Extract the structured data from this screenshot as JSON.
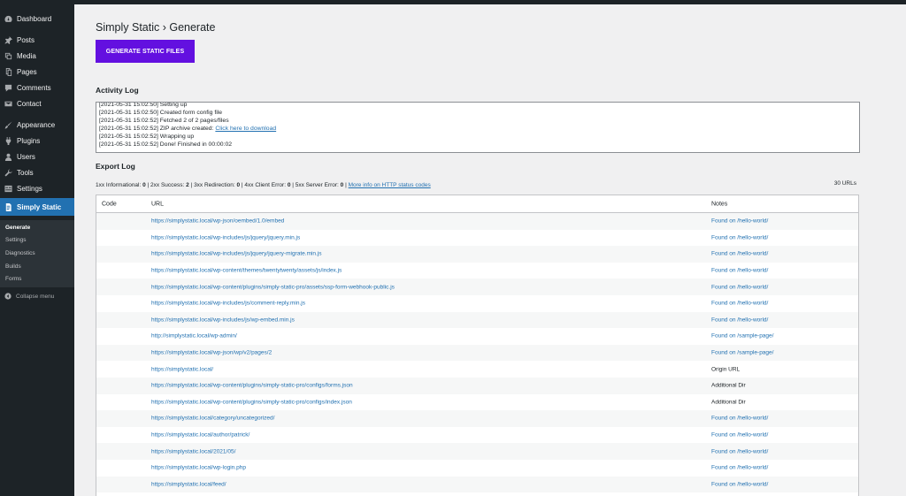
{
  "sidebar": {
    "items": [
      {
        "label": "Dashboard",
        "icon": "dashboard-icon"
      },
      {
        "label": "Posts",
        "icon": "pin-icon"
      },
      {
        "label": "Media",
        "icon": "media-icon"
      },
      {
        "label": "Pages",
        "icon": "pages-icon"
      },
      {
        "label": "Comments",
        "icon": "comments-icon"
      },
      {
        "label": "Contact",
        "icon": "mail-icon"
      },
      {
        "label": "Appearance",
        "icon": "brush-icon"
      },
      {
        "label": "Plugins",
        "icon": "plugin-icon"
      },
      {
        "label": "Users",
        "icon": "users-icon"
      },
      {
        "label": "Tools",
        "icon": "wrench-icon"
      },
      {
        "label": "Settings",
        "icon": "settings-icon"
      },
      {
        "label": "Simply Static",
        "icon": "document-icon"
      }
    ],
    "submenu": [
      "Generate",
      "Settings",
      "Diagnostics",
      "Builds",
      "Forms"
    ],
    "collapse_label": "Collapse menu"
  },
  "main": {
    "title": "Simply Static › Generate",
    "generate_button": "GENERATE STATIC FILES",
    "activity_title": "Activity Log",
    "activity_log": [
      "[2021-05-31 15:02:50] Setting up",
      "[2021-05-31 15:02:50] Created form config file",
      "[2021-05-31 15:02:52] Fetched 2 of 2 pages/files",
      "[2021-05-31 15:02:52] ZIP archive created: ",
      "[2021-05-31 15:02:52] Wrapping up",
      "[2021-05-31 15:02:52] Done! Finished in 00:00:02"
    ],
    "download_link": "Click here to download",
    "export_title": "Export Log",
    "status": {
      "informational": "1xx Informational: ",
      "informational_count": "0",
      "success": " | 2xx Success: ",
      "success_count": "2",
      "redirection": " | 3xx Redirection: ",
      "redirection_count": "0",
      "client_error": " | 4xx Client Error: ",
      "client_error_count": "0",
      "server_error": " | 5xx Server Error: ",
      "server_error_count": "0",
      "separator": " | ",
      "more_info": "More info on HTTP status codes"
    },
    "url_count": "30 URLs",
    "table": {
      "headers": {
        "code": "Code",
        "url": "URL",
        "notes": "Notes"
      },
      "rows": [
        {
          "url": "https://simplystatic.local/wp-json/oembed/1.0/embed",
          "notes": "Found on /hello-world/",
          "link": true
        },
        {
          "url": "https://simplystatic.local/wp-includes/js/jquery/jquery.min.js",
          "notes": "Found on /hello-world/",
          "link": true
        },
        {
          "url": "https://simplystatic.local/wp-includes/js/jquery/jquery-migrate.min.js",
          "notes": "Found on /hello-world/",
          "link": true
        },
        {
          "url": "https://simplystatic.local/wp-content/themes/twentytwenty/assets/js/index.js",
          "notes": "Found on /hello-world/",
          "link": true
        },
        {
          "url": "https://simplystatic.local/wp-content/plugins/simply-static-pro/assets/ssp-form-webhook-public.js",
          "notes": "Found on /hello-world/",
          "link": true
        },
        {
          "url": "https://simplystatic.local/wp-includes/js/comment-reply.min.js",
          "notes": "Found on /hello-world/",
          "link": true
        },
        {
          "url": "https://simplystatic.local/wp-includes/js/wp-embed.min.js",
          "notes": "Found on /hello-world/",
          "link": true
        },
        {
          "url": "http://simplystatic.local/wp-admin/",
          "notes": "Found on /sample-page/",
          "link": true
        },
        {
          "url": "https://simplystatic.local/wp-json/wp/v2/pages/2",
          "notes": "Found on /sample-page/",
          "link": true
        },
        {
          "url": "https://simplystatic.local/",
          "notes": "Origin URL",
          "link": false
        },
        {
          "url": "https://simplystatic.local/wp-content/plugins/simply-static-pro/configs/forms.json",
          "notes": "Additional Dir",
          "link": false
        },
        {
          "url": "https://simplystatic.local/wp-content/plugins/simply-static-pro/configs/index.json",
          "notes": "Additional Dir",
          "link": false
        },
        {
          "url": "https://simplystatic.local/category/uncategorized/",
          "notes": "Found on /hello-world/",
          "link": true
        },
        {
          "url": "https://simplystatic.local/author/patrick/",
          "notes": "Found on /hello-world/",
          "link": true
        },
        {
          "url": "https://simplystatic.local/2021/05/",
          "notes": "Found on /hello-world/",
          "link": true
        },
        {
          "url": "https://simplystatic.local/wp-login.php",
          "notes": "Found on /hello-world/",
          "link": true
        },
        {
          "url": "https://simplystatic.local/feed/",
          "notes": "Found on /hello-world/",
          "link": true
        }
      ]
    }
  },
  "colors": {
    "sidebar_bg": "#1d2327",
    "accent": "#2271b1",
    "button_bg": "#6310e0",
    "page_bg": "#f0f0f1"
  }
}
